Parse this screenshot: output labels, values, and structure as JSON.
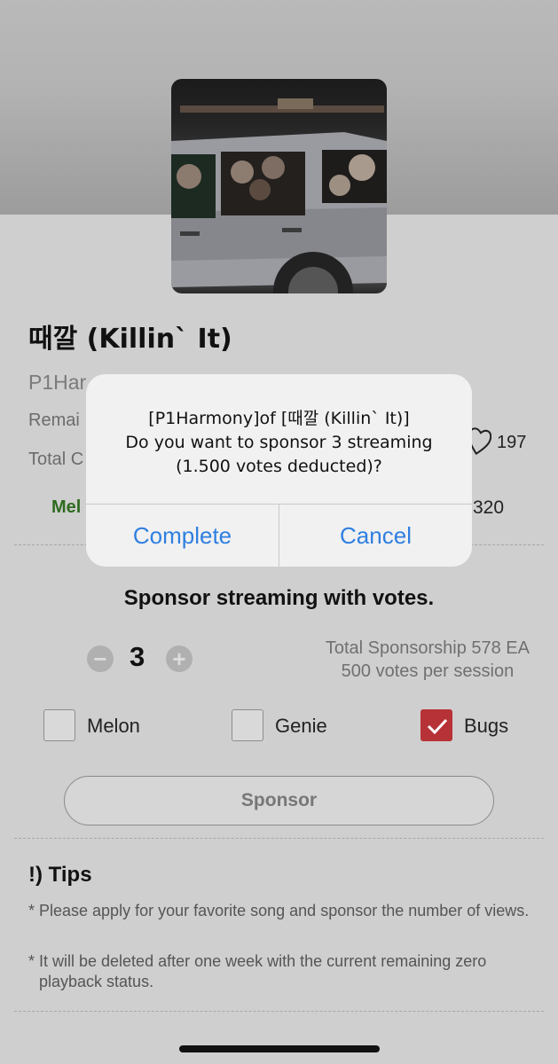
{
  "song": {
    "title": "때깔 (Killin` It)",
    "artist_partial": "P1Har",
    "remain_label_partial": "Remai",
    "total_label_partial": "Total C",
    "likes": "197",
    "melon_partial": "Mel",
    "bugs_value_partial": "320"
  },
  "sponsor": {
    "heading": "Sponsor streaming with votes.",
    "minus_label": "−",
    "plus_label": "+",
    "count": "3",
    "total_line": "Total Sponsorship 578 EA",
    "per_session_line": "500 votes per session",
    "platforms": [
      {
        "label": "Melon",
        "checked": false
      },
      {
        "label": "Genie",
        "checked": false
      },
      {
        "label": "Bugs",
        "checked": true
      }
    ],
    "button_label": "Sponsor"
  },
  "tips": {
    "title": "!) Tips",
    "items": [
      "Please apply for your favorite song and sponsor the number of views.",
      "It will be deleted after one week with the current remaining zero playback status."
    ],
    "bullet": "*"
  },
  "alert": {
    "line1": "[P1Harmony]of [때깔 (Killin` It)]",
    "line2": "Do you want to sponsor 3 streaming",
    "line3": "(1.500 votes deducted)?",
    "confirm_label": "Complete",
    "cancel_label": "Cancel"
  },
  "colors": {
    "accent_blue": "#2f7fe0",
    "checked_red": "#b73236",
    "melon_green": "#2f6b21"
  }
}
